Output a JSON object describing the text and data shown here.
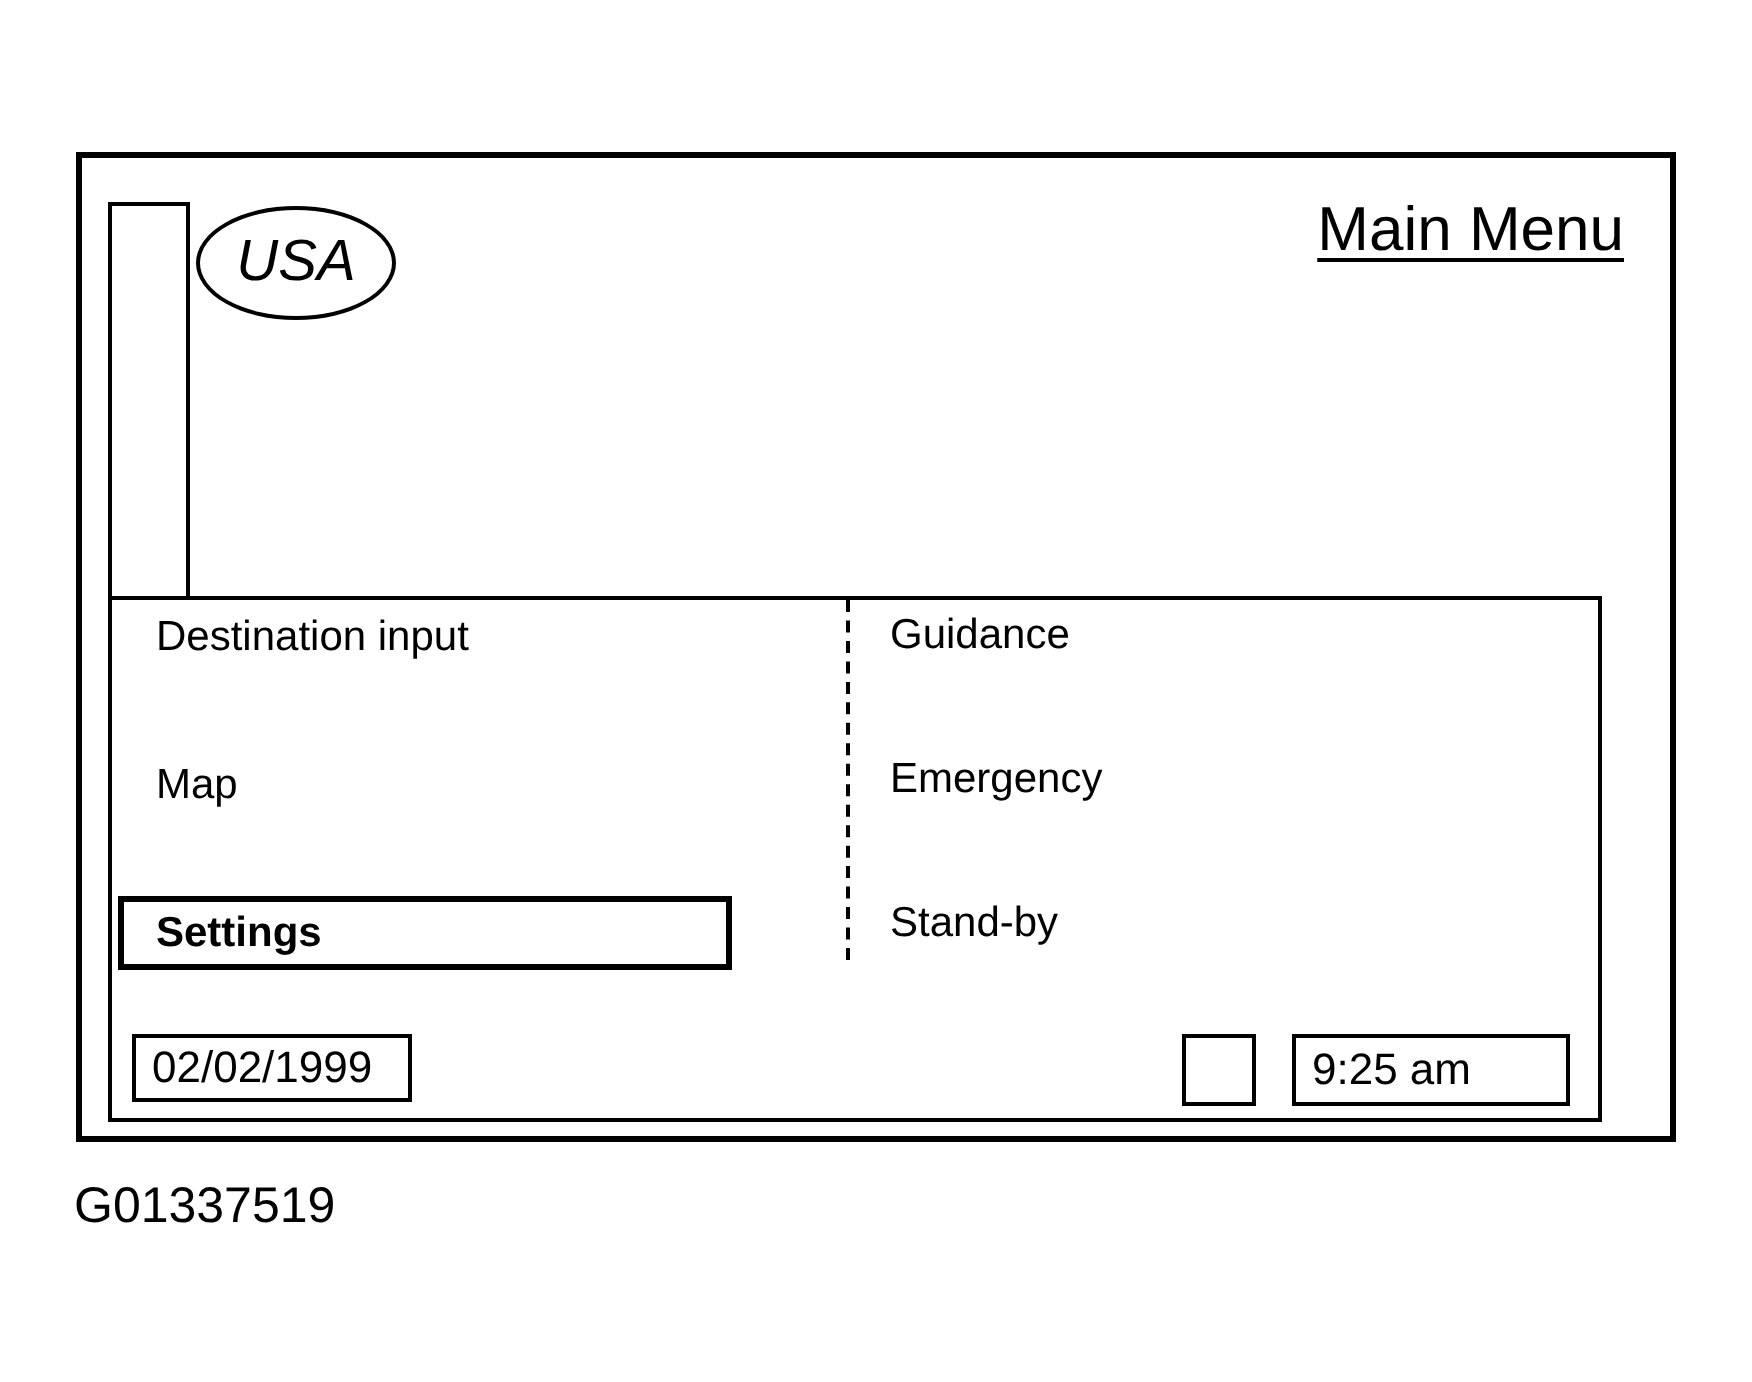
{
  "screen": {
    "region": "USA",
    "title": "Main Menu"
  },
  "menu": {
    "columns": [
      {
        "items": [
          {
            "label": "Destination input",
            "selected": false
          },
          {
            "label": "Map",
            "selected": false
          },
          {
            "label": "Settings",
            "selected": true
          }
        ]
      },
      {
        "items": [
          {
            "label": "Guidance",
            "selected": false
          },
          {
            "label": "Emergency",
            "selected": false
          },
          {
            "label": "Stand-by",
            "selected": false
          }
        ]
      }
    ]
  },
  "status_bar": {
    "date": "02/02/1999",
    "time": "9:25 am"
  },
  "caption": "G01337519"
}
